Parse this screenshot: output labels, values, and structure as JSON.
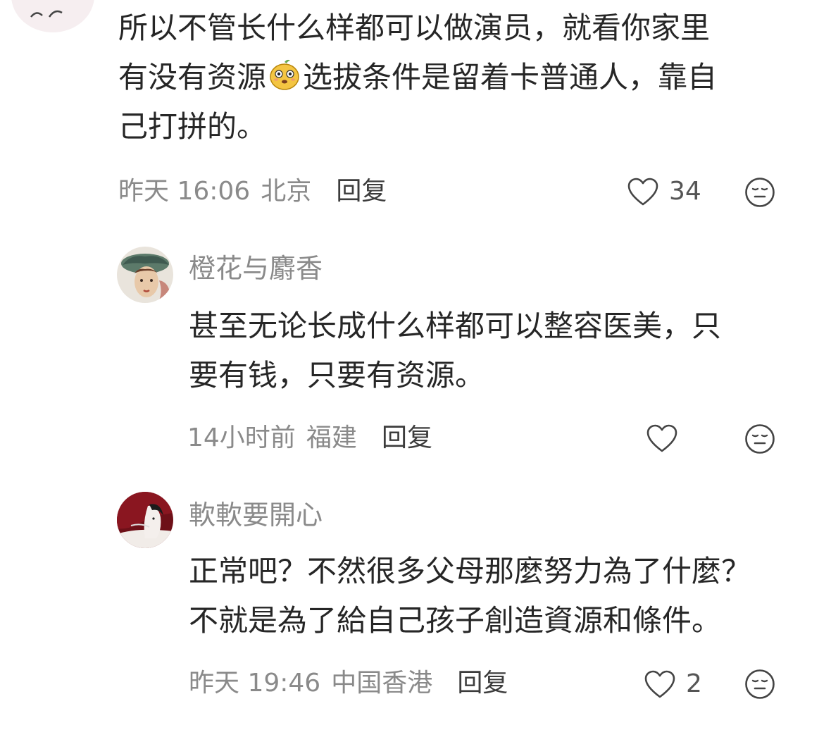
{
  "comments": [
    {
      "lines": [
        "所以不管长什么样都可以做演员，就看你家里",
        "有没有资源",
        "选拔条件是留着卡普通人，靠自",
        "己打拼的。"
      ],
      "time": "昨天 16:06",
      "location": "北京",
      "reply_label": "回复",
      "likes": "34",
      "emoji_icon": "sticker-emoji-icon"
    },
    {
      "username": "橙花与麝香",
      "lines": [
        "甚至无论长成什么样都可以整容医美，只",
        "要有钱，只要有资源。"
      ],
      "time": "14小时前",
      "location": "福建",
      "reply_label": "回复",
      "likes": ""
    },
    {
      "username": "軟軟要開心",
      "lines": [
        "正常吧？不然很多父母那麼努力為了什麼？",
        "不就是為了給自己孩子創造資源和條件。"
      ],
      "time": "昨天 19:46",
      "location": "中国香港",
      "reply_label": "回复",
      "likes": "2"
    }
  ],
  "icons": {
    "like": "heart-outline-icon",
    "emoji": "neutral-face-icon"
  },
  "colors": {
    "text": "#262626",
    "meta": "#8a8a8a",
    "background": "#ffffff"
  }
}
